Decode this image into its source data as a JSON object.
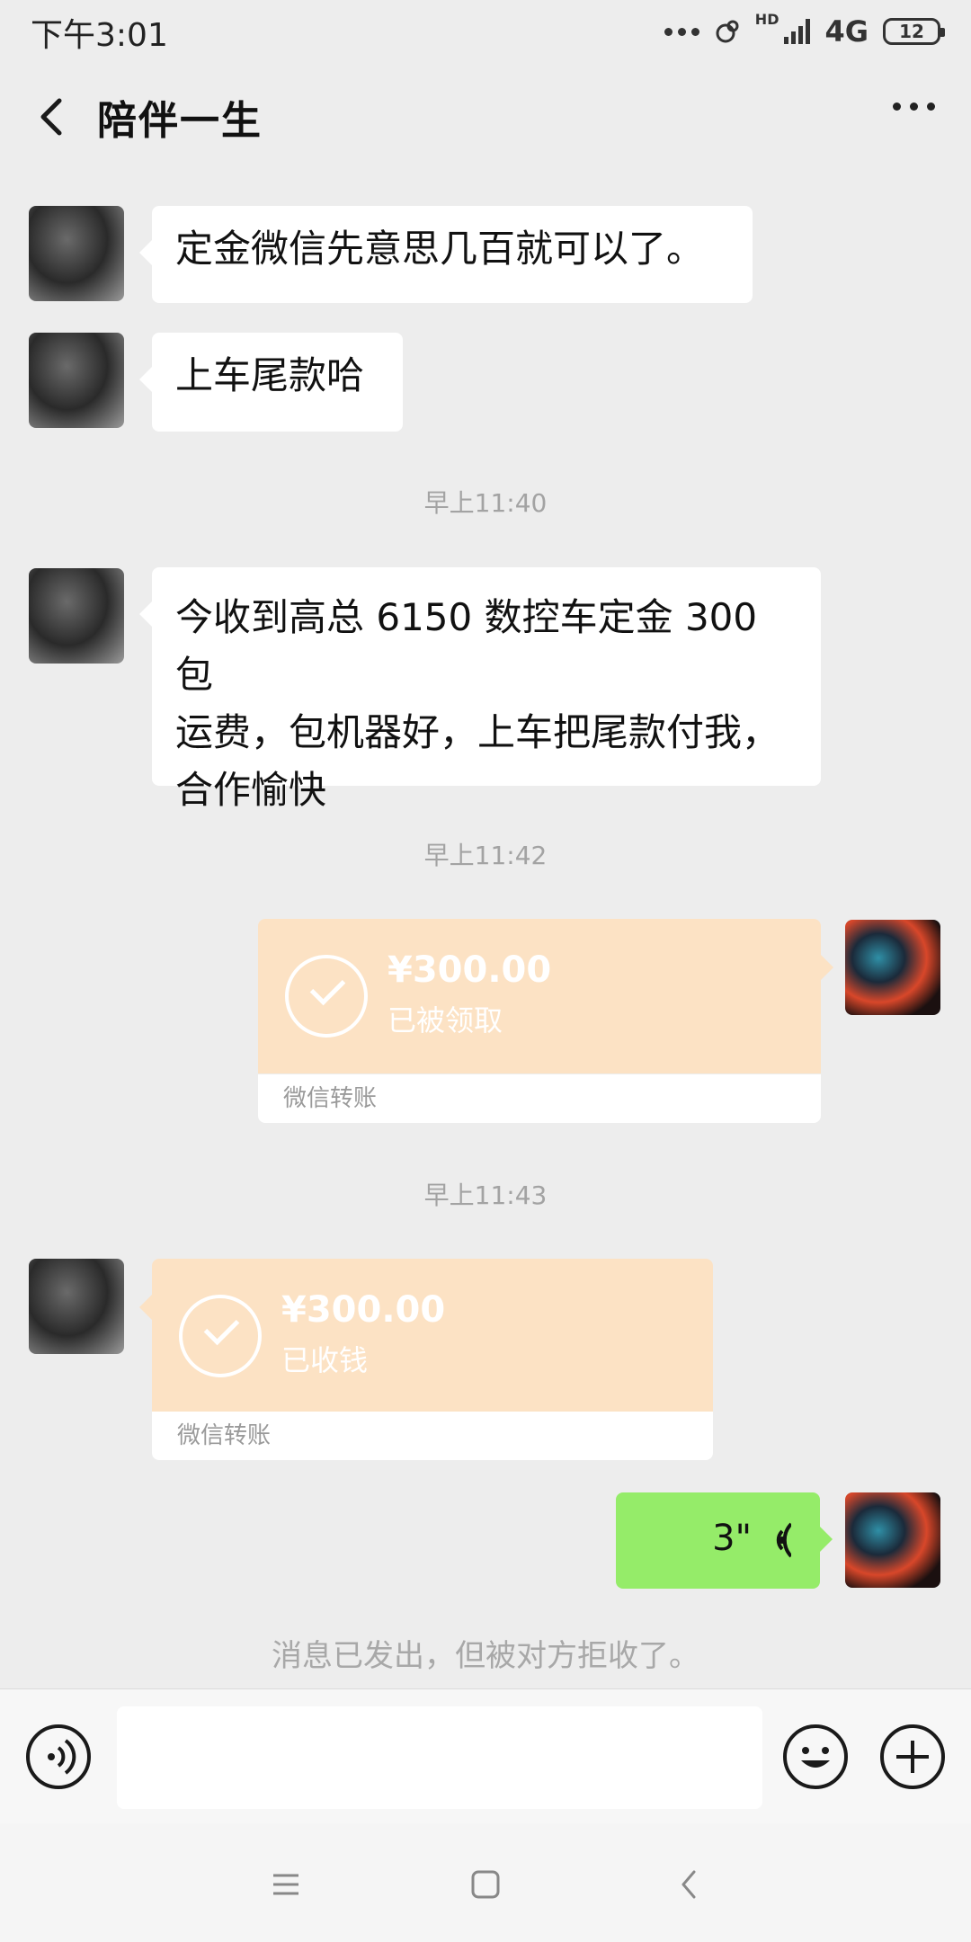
{
  "status_bar": {
    "time": "下午3:01",
    "hd": "HD",
    "network": "4G",
    "battery": "12"
  },
  "header": {
    "title": "陪伴一生"
  },
  "messages": {
    "m1": "定金微信先意思几百就可以了。",
    "m2": "上车尾款哈",
    "t1": "早上11:40",
    "m3_line1": "今收到高总 6150 数控车定金 300 包",
    "m3_line2": "运费，包机器好，上车把尾款付我，",
    "m3_line3": "合作愉快",
    "t2": "早上11:42",
    "transfer1": {
      "amount": "¥300.00",
      "status": "已被领取",
      "label": "微信转账"
    },
    "t3": "早上11:43",
    "transfer2": {
      "amount": "¥300.00",
      "status": "已收钱",
      "label": "微信转账"
    },
    "voice": {
      "duration": "3\""
    },
    "notice": "消息已发出，但被对方拒收了。"
  },
  "icons": {
    "back": "chevron-left-icon",
    "more": "more-dots-icon",
    "voice_input": "voice-mode-icon",
    "emoji": "emoji-icon",
    "add": "plus-icon",
    "nav_menu": "menu-icon",
    "nav_home": "home-icon",
    "nav_back": "back-icon"
  },
  "colors": {
    "background": "#ededed",
    "bubble_self": "#95ec69",
    "transfer": "#fce2c4"
  }
}
